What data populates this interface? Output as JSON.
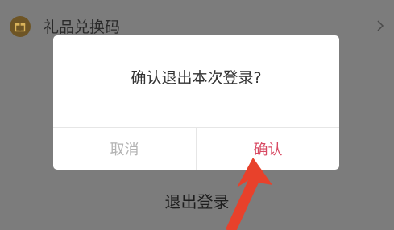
{
  "list": {
    "gift_item": {
      "label": "礼品兑换码",
      "icon": "gift-icon"
    }
  },
  "logout": {
    "label": "退出登录"
  },
  "dialog": {
    "message": "确认退出本次登录?",
    "cancel_label": "取消",
    "confirm_label": "确认",
    "confirm_color": "#d84a63"
  },
  "annotation": {
    "icon": "red-arrow",
    "color": "#e8412b"
  }
}
